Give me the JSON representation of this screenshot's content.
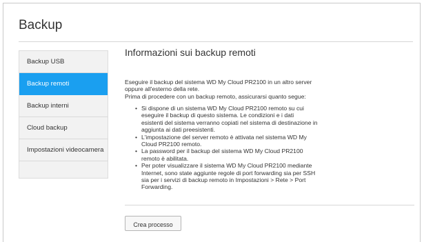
{
  "page": {
    "title": "Backup"
  },
  "sidebar": {
    "items": [
      {
        "label": "Backup USB",
        "active": false
      },
      {
        "label": "Backup remoti",
        "active": true
      },
      {
        "label": "Backup interni",
        "active": false
      },
      {
        "label": "Cloud backup",
        "active": false
      },
      {
        "label": "Impostazioni videocamera",
        "active": false
      }
    ]
  },
  "main": {
    "heading": "Informazioni sui backup remoti",
    "intro_lines": [
      "Eseguire il backup del sistema WD My Cloud PR2100 in un altro server",
      "oppure all'esterno della rete.",
      "Prima di procedere con un backup remoto, assicurarsi quanto segue:"
    ],
    "bullets": [
      {
        "lines": [
          "Si dispone di un sistema WD My Cloud PR2100 remoto su cui",
          "eseguire il backup di questo sistema. Le condizioni e i dati",
          "esistenti del sistema verranno copiati nel sistema di destinazione in",
          "aggiunta ai dati preesistenti."
        ]
      },
      {
        "lines": [
          "L'impostazione del server remoto è attivata nel sistema WD My",
          "Cloud PR2100 remoto."
        ]
      },
      {
        "lines": [
          "La password per il backup del sistema WD My Cloud PR2100",
          "remoto è abilitata."
        ]
      },
      {
        "lines": [
          "Per poter visualizzare il sistema WD My Cloud PR2100 mediante",
          "Internet, sono state aggiunte regole di port forwarding sia per SSH",
          "sia per i servizi di backup remoto in Impostazioni > Rete > Port",
          "Forwarding."
        ]
      }
    ],
    "create_button_label": "Crea processo"
  },
  "colors": {
    "accent": "#1a9ff0",
    "sidebar_bg": "#f2f2f2"
  }
}
